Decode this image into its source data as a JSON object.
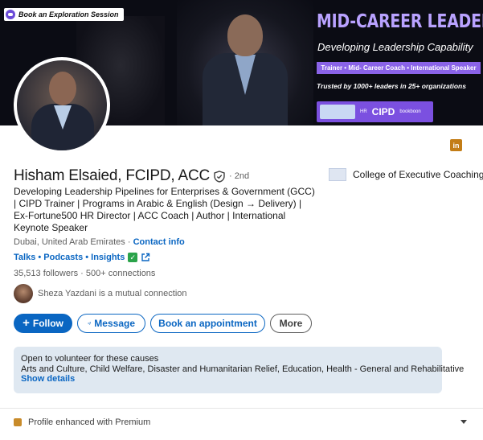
{
  "banner": {
    "book_label": "Book an Exploration Session",
    "title": "MID-CAREER LEADERS",
    "subtitle": "Developing Leadership Capability",
    "tags": "Trainer • Mid- Career Coach • International Speaker",
    "trust": "Trusted by 1000+ leaders in 25+ organizations",
    "logo_cipd": "CIPD",
    "logo_hr": "HR",
    "logo_bookboon": "bookboon"
  },
  "profile": {
    "name": "Hisham Elsaied, FCIPD, ACC",
    "degree": "· 2nd",
    "company": "College of Executive Coaching",
    "headline": "Developing Leadership Pipelines for Enterprises & Government (GCC) | CIPD Trainer | Programs in Arabic & English (Design → Delivery) | Ex-Fortune500 HR Director | ACC Coach | Author | International Keynote Speaker",
    "location": "Dubai, United Arab Emirates",
    "location_sep": " · ",
    "contact_info": "Contact info",
    "links": "Talks • Podcasts • Insights",
    "followers": "35,513 followers",
    "stats_sep": " · ",
    "connections": "500+ connections",
    "mutual_name": "Sheza Yazdani",
    "mutual_suffix": " is a mutual connection"
  },
  "actions": {
    "follow": "Follow",
    "message": "Message",
    "appointment": "Book an appointment",
    "more": "More"
  },
  "volunteer": {
    "title": "Open to volunteer for these causes",
    "causes": "Arts and Culture, Child Welfare, Disaster and Humanitarian Relief, Education, Health - General and Rehabilitative",
    "show_details": "Show details"
  },
  "premium": {
    "label": "Profile enhanced with Premium"
  },
  "colors": {
    "accent": "#0a66c2",
    "banner_purple": "#8a63e8",
    "banner_title": "#b9a2ff"
  }
}
